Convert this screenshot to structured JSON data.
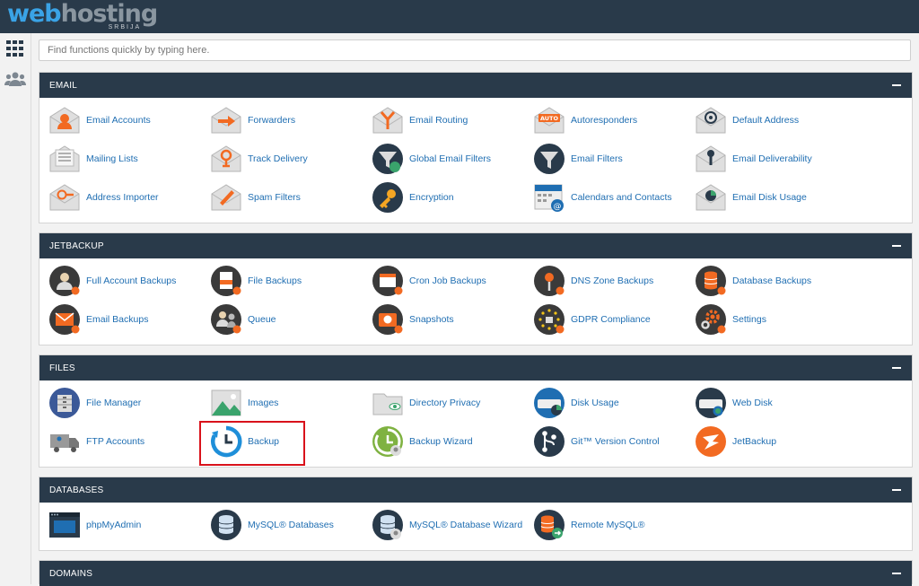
{
  "brand": {
    "logo_web": "web",
    "logo_hosting": "hosting",
    "logo_sub": "SRBIJA"
  },
  "sidebar": {
    "items": [
      {
        "icon": "apps-grid-icon"
      },
      {
        "icon": "users-icon"
      }
    ]
  },
  "search": {
    "placeholder": "Find functions quickly by typing here."
  },
  "sections": {
    "email": {
      "title": "EMAIL",
      "items": [
        {
          "label": "Email Accounts",
          "icon": "email-accounts-icon"
        },
        {
          "label": "Forwarders",
          "icon": "forwarders-icon"
        },
        {
          "label": "Email Routing",
          "icon": "email-routing-icon"
        },
        {
          "label": "Autoresponders",
          "icon": "autoresponders-icon"
        },
        {
          "label": "Default Address",
          "icon": "default-address-icon"
        },
        {
          "label": "Mailing Lists",
          "icon": "mailing-lists-icon"
        },
        {
          "label": "Track Delivery",
          "icon": "track-delivery-icon"
        },
        {
          "label": "Global Email Filters",
          "icon": "global-email-filters-icon"
        },
        {
          "label": "Email Filters",
          "icon": "email-filters-icon"
        },
        {
          "label": "Email Deliverability",
          "icon": "email-deliverability-icon"
        },
        {
          "label": "Address Importer",
          "icon": "address-importer-icon"
        },
        {
          "label": "Spam Filters",
          "icon": "spam-filters-icon"
        },
        {
          "label": "Encryption",
          "icon": "encryption-icon"
        },
        {
          "label": "Calendars and Contacts",
          "icon": "calendars-contacts-icon"
        },
        {
          "label": "Email Disk Usage",
          "icon": "email-disk-usage-icon"
        }
      ],
      "autoresponder_badge": "AUTO"
    },
    "jetbackup": {
      "title": "JETBACKUP",
      "items": [
        {
          "label": "Full Account Backups",
          "icon": "full-account-backups-icon"
        },
        {
          "label": "File Backups",
          "icon": "file-backups-icon"
        },
        {
          "label": "Cron Job Backups",
          "icon": "cron-job-backups-icon"
        },
        {
          "label": "DNS Zone Backups",
          "icon": "dns-zone-backups-icon"
        },
        {
          "label": "Database Backups",
          "icon": "database-backups-icon"
        },
        {
          "label": "Email Backups",
          "icon": "email-backups-icon"
        },
        {
          "label": "Queue",
          "icon": "queue-icon"
        },
        {
          "label": "Snapshots",
          "icon": "snapshots-icon"
        },
        {
          "label": "GDPR Compliance",
          "icon": "gdpr-compliance-icon"
        },
        {
          "label": "Settings",
          "icon": "settings-icon"
        }
      ]
    },
    "files": {
      "title": "FILES",
      "items": [
        {
          "label": "File Manager",
          "icon": "file-manager-icon"
        },
        {
          "label": "Images",
          "icon": "images-icon"
        },
        {
          "label": "Directory Privacy",
          "icon": "directory-privacy-icon"
        },
        {
          "label": "Disk Usage",
          "icon": "disk-usage-icon"
        },
        {
          "label": "Web Disk",
          "icon": "web-disk-icon"
        },
        {
          "label": "FTP Accounts",
          "icon": "ftp-accounts-icon"
        },
        {
          "label": "Backup",
          "icon": "backup-icon",
          "highlighted": true
        },
        {
          "label": "Backup Wizard",
          "icon": "backup-wizard-icon"
        },
        {
          "label": "Git™ Version Control",
          "icon": "git-version-control-icon"
        },
        {
          "label": "JetBackup",
          "icon": "jetbackup-icon"
        }
      ]
    },
    "databases": {
      "title": "DATABASES",
      "items": [
        {
          "label": "phpMyAdmin",
          "icon": "phpmyadmin-icon"
        },
        {
          "label": "MySQL® Databases",
          "icon": "mysql-databases-icon"
        },
        {
          "label": "MySQL® Database Wizard",
          "icon": "mysql-database-wizard-icon"
        },
        {
          "label": "Remote MySQL®",
          "icon": "remote-mysql-icon"
        }
      ]
    },
    "domains": {
      "title": "DOMAINS"
    }
  },
  "colors": {
    "header_bg": "#293a4a",
    "link": "#1f6eb2",
    "accent_orange": "#f26a22",
    "highlight_border": "#d9121b"
  }
}
